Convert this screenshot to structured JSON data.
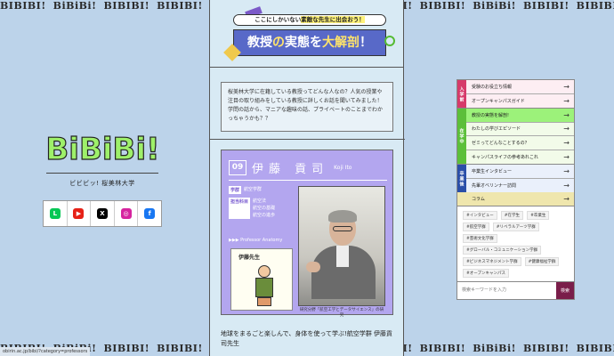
{
  "marquee_top": [
    "BIBIBI!",
    "BiBiBi!",
    "BIBIBI!",
    "BIBIBI!",
    "BIBIBI!",
    "BiBiBi!",
    "BIBIBI!",
    "BIBIBI!",
    "BIBIBI!",
    "BiBiBi!",
    "BIBIBI!",
    "BIBIBI!",
    "BIBIBI!",
    "BiBiBi!",
    "BIBIBI!"
  ],
  "marquee_bottom": [
    "BIBIBI!",
    "BiBiBi!",
    "BIBIBI!",
    "BIBIBI!",
    "BIBIBI!",
    "BiBiBi!",
    "BIBIBI!",
    "BIBIBI!",
    "BIBIBI!",
    "BiBiBi!",
    "BIBIBI!",
    "BIBIBI!",
    "BIBIBI!",
    "BiBiBi!",
    "BIBIBI!"
  ],
  "brand": {
    "logo_letters": [
      "B",
      "i",
      "B",
      "i",
      "B",
      "i",
      "!"
    ],
    "subtitle": "ビビビッ! 桜美林大学"
  },
  "social": [
    {
      "name": "LINE",
      "glyph": "L",
      "color": "#06c755"
    },
    {
      "name": "YouTube",
      "glyph": "▶",
      "color": "#e62117"
    },
    {
      "name": "X",
      "glyph": "X",
      "color": "#000000"
    },
    {
      "name": "Instagram",
      "glyph": "◎",
      "color": "#d6249f"
    },
    {
      "name": "Facebook",
      "glyph": "f",
      "color": "#1877f2"
    }
  ],
  "hero": {
    "pill_pre": "ここにしかいない",
    "pill_hl": "素敵な先生に出会おう！",
    "banner_a": "教授",
    "banner_b": "の",
    "banner_c": "実態",
    "banner_d": "を",
    "banner_e": "大解剖",
    "banner_f": "！"
  },
  "intro": "桜美林大学に在籍している教授ってどんな人なの？人気の授業や注目の取り組みをしている教授に詳しくお話を聞いてみました！学問の話から、マニアな趣味の話、プライベートのことまでわかっちゃうかも？？",
  "card": {
    "number": "09",
    "name": "伊藤 貢司",
    "romaji": "Koji Ito",
    "tags": [
      {
        "key": "学群",
        "value": "航空学群"
      },
      {
        "key": "担当科目",
        "value": "航空法\n航空の基礎\n航空の進歩"
      }
    ],
    "anatomy_label": "▶▶▶ Professor Anatomy",
    "sketch_title": "伊藤先生",
    "photo_caption": "研究分野「航空工学とデータサイエンス」の研究",
    "headline": "地球をまるごと楽しんで、身体を使って学ぶ!航空学群 伊藤貢司先生"
  },
  "nav": {
    "groups": [
      {
        "label": "入学前",
        "color": "#d63a6a",
        "items": [
          "受験のお役立ち情報",
          "オープンキャンパスガイド"
        ]
      },
      {
        "label": "在学中",
        "color": "#5cbf3a",
        "items": [
          "教授の実態を解剖!",
          "わたしの学びエピソード",
          "ゼミってどんなことするの？",
          "キャンパスライフの参考あれこれ"
        ]
      },
      {
        "label": "卒業後",
        "color": "#2a4ea8",
        "items": [
          "卒業生インタビュー",
          "先輩オベリンナー訪問"
        ]
      }
    ],
    "column_label": "コラム",
    "active_index": 2,
    "hashtags": [
      "#インタビュー",
      "#在学生",
      "#卒業生",
      "#航空学群",
      "#リベラルアーツ学群",
      "#芸術文化学群",
      "#グローバル・コミュニケーション学群",
      "#ビジネスマネジメント学群",
      "#健康福祉学群",
      "#オープンキャンパス"
    ],
    "search_placeholder": "検索キーワードを入力",
    "search_button": "検索"
  },
  "status_url": "obirin.ac.jp/bibi/?category=professors"
}
